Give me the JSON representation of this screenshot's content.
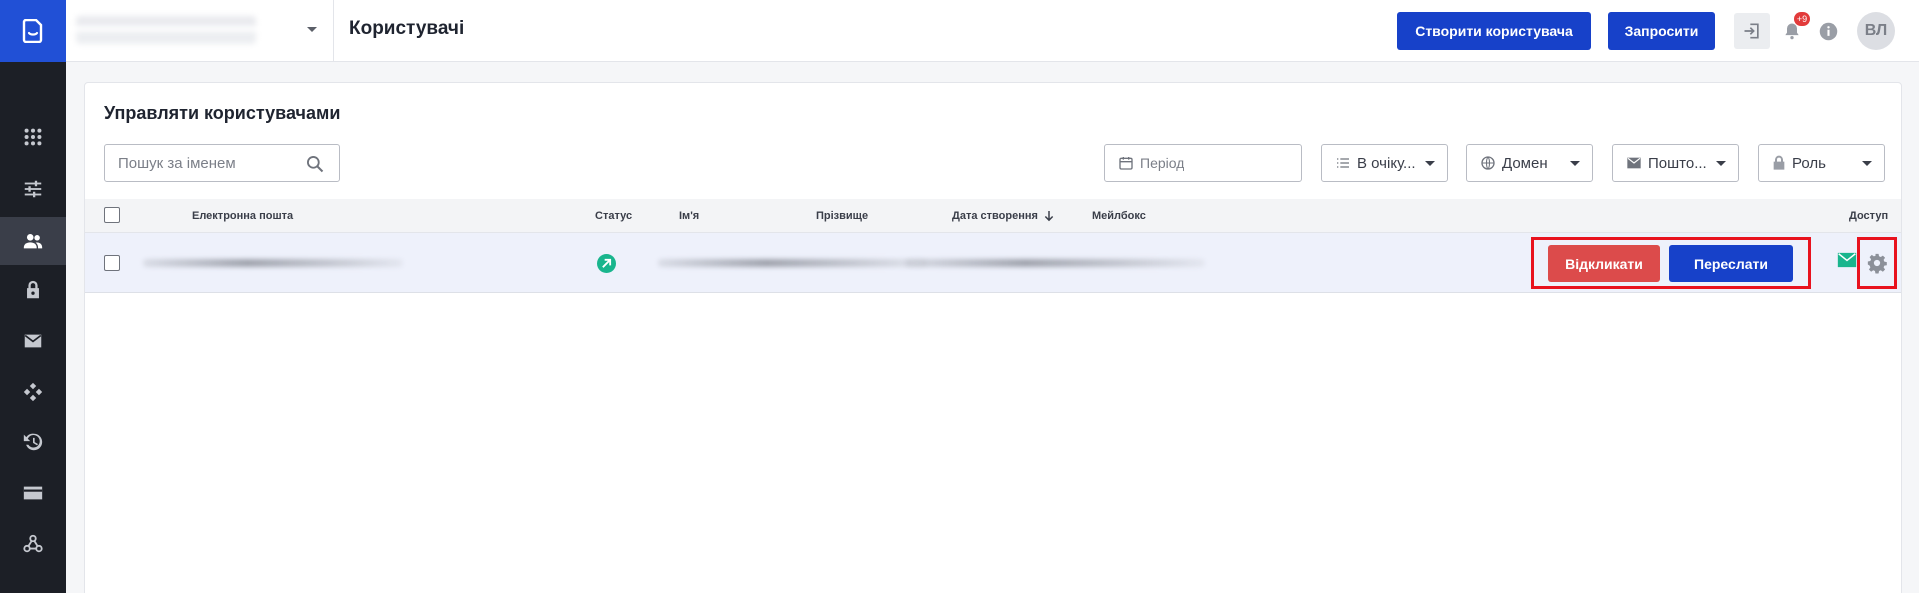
{
  "topbar": {
    "page_title": "Користувачі",
    "create_user_label": "Створити користувача",
    "invite_label": "Запросити",
    "notification_count": "+9",
    "avatar_initials": "ВЛ"
  },
  "sidebar": {
    "items": [
      {
        "icon": "apps-grid-icon"
      },
      {
        "icon": "settings-sliders-icon"
      },
      {
        "icon": "users-icon",
        "active": true
      },
      {
        "icon": "lock-icon"
      },
      {
        "icon": "mail-icon"
      },
      {
        "icon": "integrations-icon"
      },
      {
        "icon": "history-icon"
      },
      {
        "icon": "billing-card-icon"
      },
      {
        "icon": "webhooks-icon"
      }
    ]
  },
  "main": {
    "title": "Управляти користувачами",
    "search_placeholder": "Пошук за іменем",
    "filters": {
      "period_placeholder": "Період",
      "status": "В очіку...",
      "domain": "Домен",
      "mailbox": "Пошто...",
      "role": "Роль"
    },
    "table": {
      "columns": {
        "email": "Електронна пошта",
        "status": "Статус",
        "first_name": "Ім'я",
        "last_name": "Прізвище",
        "created": "Дата створення",
        "mailbox": "Мейлбокс",
        "access": "Доступ"
      },
      "row": {
        "revoke_label": "Відкликати",
        "resend_label": "Переслати"
      }
    }
  },
  "colors": {
    "primary": "#1741c9",
    "danger": "#dc4b4b",
    "status_pending": "#19b58d",
    "sidebar_bg": "#1c1f26",
    "highlight": "#e8121e"
  }
}
